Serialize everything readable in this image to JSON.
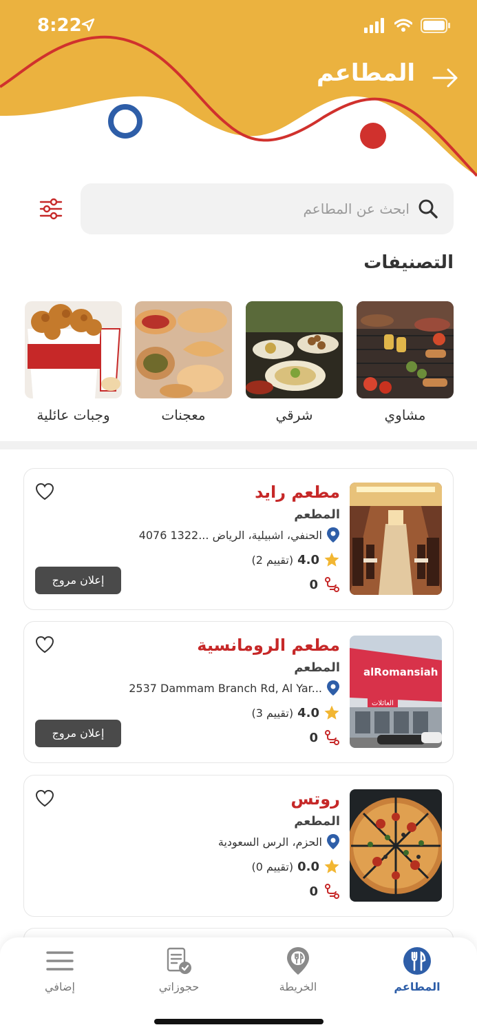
{
  "status_bar": {
    "time": "8:22"
  },
  "header": {
    "title": "المطاعم"
  },
  "search": {
    "placeholder": "ابحث عن المطاعم"
  },
  "categories_section": {
    "title": "التصنيفات",
    "items": [
      {
        "label": "مشاوي"
      },
      {
        "label": "شرقي"
      },
      {
        "label": "معجنات"
      },
      {
        "label": "وجبات عائلية"
      }
    ]
  },
  "restaurants": [
    {
      "name": "مطعم رايد",
      "type": "المطعم",
      "address": "4076 الحنفي، اشبيلية، الرياض ...1322",
      "rating": "4.0",
      "rating_count": "(2 تقييم)",
      "distance": "0",
      "promo_label": "إعلان مروج",
      "image_brand": ""
    },
    {
      "name": "مطعم الرومانسية",
      "type": "المطعم",
      "address": "2537 Dammam Branch Rd, Al Yar...",
      "rating": "4.0",
      "rating_count": "(3 تقييم)",
      "distance": "0",
      "promo_label": "إعلان مروج",
      "image_brand": "alRomansiah",
      "image_sign": "العائلات"
    },
    {
      "name": "روتس",
      "type": "المطعم",
      "address": "الحزم، الرس السعودية",
      "rating": "0.0",
      "rating_count": "(0 تقييم)",
      "distance": "0"
    }
  ],
  "tabbar": {
    "tabs": [
      {
        "label": "المطاعم",
        "icon": "restaurant-icon",
        "active": true
      },
      {
        "label": "الخريطة",
        "icon": "map-pin-icon",
        "active": false
      },
      {
        "label": "حجوزاتي",
        "icon": "bookings-icon",
        "active": false
      },
      {
        "label": "إضافي",
        "icon": "menu-icon",
        "active": false
      }
    ]
  },
  "colors": {
    "header_yellow": "#EBB23F",
    "wave_red": "#D0312D",
    "accent_red": "#C62828",
    "circle_blue": "#2E5EA8",
    "star_yellow": "#F2B632",
    "active_tab_blue": "#2E5EA8"
  }
}
